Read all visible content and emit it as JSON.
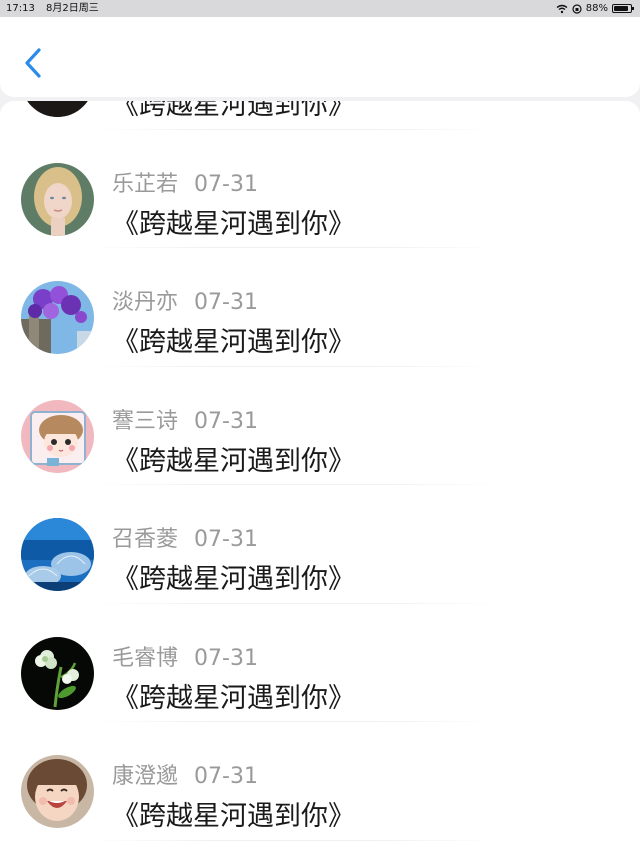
{
  "status_bar": {
    "time": "17:13",
    "date": "8月2日周三",
    "battery": "88%",
    "battery_level": 0.88
  },
  "nav": {
    "back_icon": "chevron-left-icon",
    "accent_color": "#2a8bea"
  },
  "comments": [
    {
      "name": "",
      "date": "",
      "text": "《跨越星河遇到你》",
      "avatar": "dark-partial"
    },
    {
      "name": "乐芷若",
      "date": "07-31",
      "text": "《跨越星河遇到你》",
      "avatar": "blonde-woman"
    },
    {
      "name": "淡丹亦",
      "date": "07-31",
      "text": "《跨越星河遇到你》",
      "avatar": "purple-flowers"
    },
    {
      "name": "謇三诗",
      "date": "07-31",
      "text": "《跨越星河遇到你》",
      "avatar": "cartoon-girl"
    },
    {
      "name": "召香菱",
      "date": "07-31",
      "text": "《跨越星河遇到你》",
      "avatar": "blue-city"
    },
    {
      "name": "毛睿博",
      "date": "07-31",
      "text": "《跨越星河遇到你》",
      "avatar": "white-flower"
    },
    {
      "name": "康澄邈",
      "date": "07-31",
      "text": "《跨越星河遇到你》",
      "avatar": "smiling-child"
    }
  ]
}
